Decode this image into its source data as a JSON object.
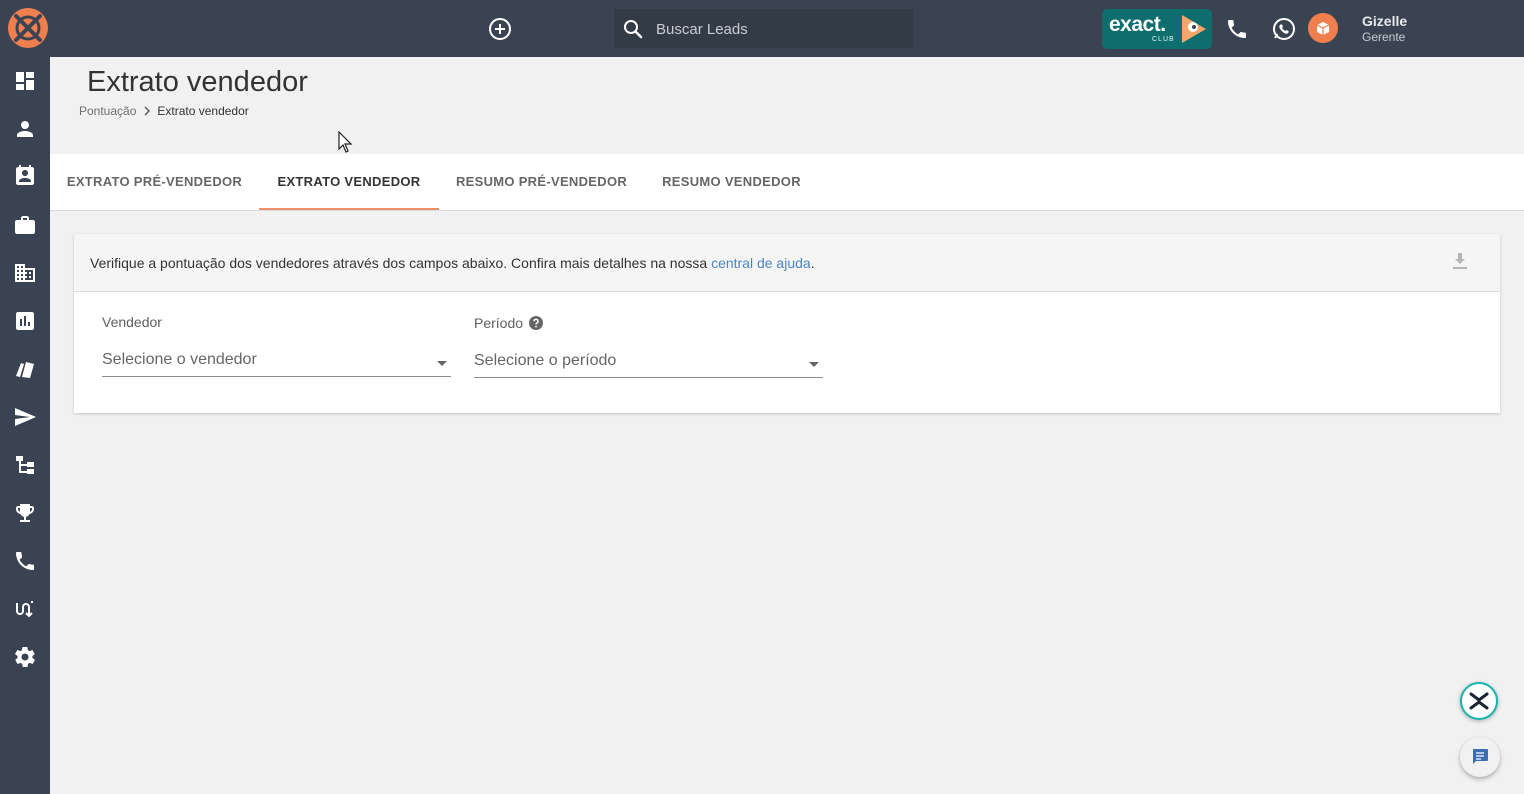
{
  "header": {
    "search_placeholder": "Buscar Leads",
    "exact_badge": {
      "brand": "exact.",
      "sub": "CLUB"
    },
    "user": {
      "name": "Gizelle",
      "role": "Gerente"
    }
  },
  "sidebar": {
    "items": [
      {
        "icon": "dashboard-icon"
      },
      {
        "icon": "person-icon"
      },
      {
        "icon": "contact-card-icon"
      },
      {
        "icon": "briefcase-icon"
      },
      {
        "icon": "building-icon"
      },
      {
        "icon": "bar-chart-icon"
      },
      {
        "icon": "cards-icon"
      },
      {
        "icon": "send-icon"
      },
      {
        "icon": "hierarchy-icon"
      },
      {
        "icon": "trophy-icon"
      },
      {
        "icon": "phone-icon"
      },
      {
        "icon": "swap-icon"
      },
      {
        "icon": "gear-icon"
      }
    ]
  },
  "page": {
    "title": "Extrato vendedor",
    "breadcrumb": {
      "parent": "Pontuação",
      "current": "Extrato vendedor"
    }
  },
  "tabs": [
    {
      "label": "EXTRATO PRÉ-VENDEDOR",
      "active": false
    },
    {
      "label": "EXTRATO VENDEDOR",
      "active": true
    },
    {
      "label": "RESUMO PRÉ-VENDEDOR",
      "active": false
    },
    {
      "label": "RESUMO VENDEDOR",
      "active": false
    }
  ],
  "card": {
    "info_text": "Verifique a pontuação dos vendedores através dos campos abaixo. Confira mais detalhes na nossa ",
    "help_link": "central de ajuda",
    "info_suffix": ".",
    "fields": {
      "vendedor": {
        "label": "Vendedor",
        "value": "Selecione o vendedor"
      },
      "periodo": {
        "label": "Período",
        "value": "Selecione o período"
      }
    }
  },
  "colors": {
    "topbar": "#3a4352",
    "accent_tab": "#ef8f69",
    "link": "#4a86c5",
    "exact_badge": "#0e6d6d",
    "avatar": "#f07f50"
  }
}
